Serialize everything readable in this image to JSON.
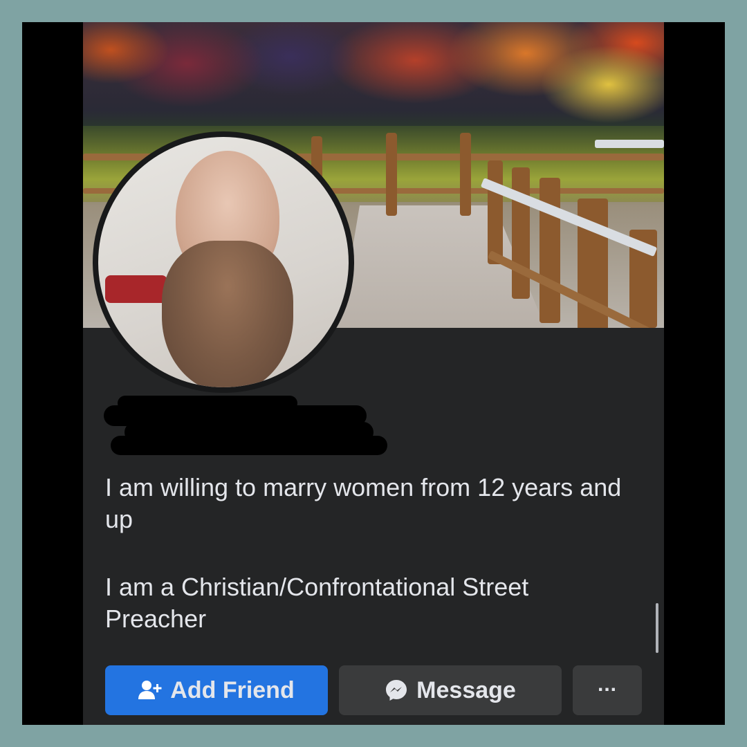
{
  "profile": {
    "bio_line1": "I am willing to marry women from 12 years and up",
    "bio_line2": "I am a Christian/Confrontational Street Preacher"
  },
  "actions": {
    "add_friend_label": "Add Friend",
    "message_label": "Message",
    "more_label": "..."
  },
  "icons": {
    "add_friend": "add-friend-icon",
    "message": "messenger-icon",
    "more": "more-options-icon"
  },
  "colors": {
    "primary_button": "#2374e1",
    "secondary_button": "#3a3b3c",
    "surface": "#242526",
    "text": "#e4e6eb"
  }
}
